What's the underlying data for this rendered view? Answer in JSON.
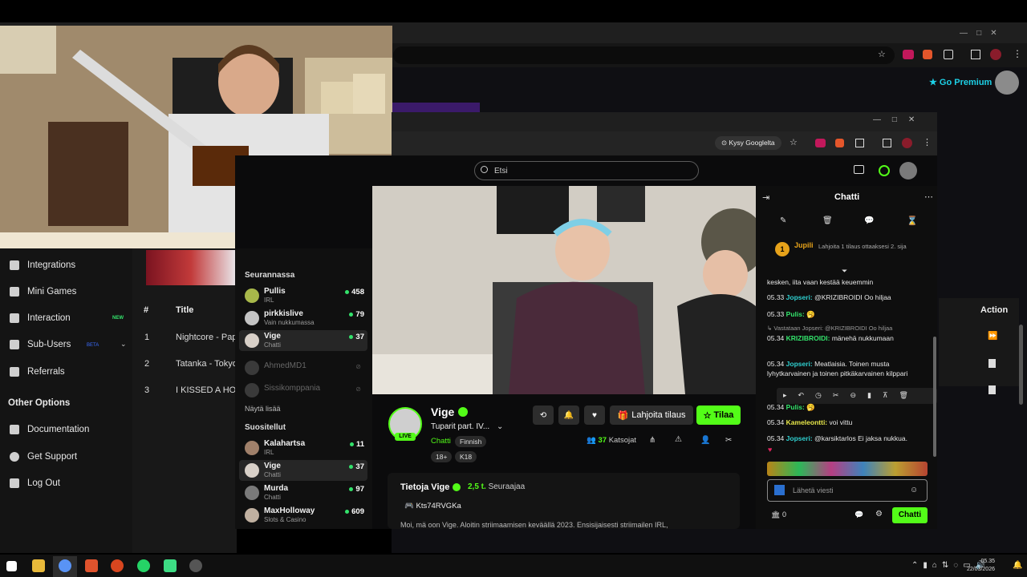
{
  "outer": {
    "go_premium": "Go Premium"
  },
  "sidebar": {
    "items": [
      {
        "label": "Integrations"
      },
      {
        "label": "Mini Games"
      },
      {
        "label": "Interaction",
        "badge": "NEW"
      },
      {
        "label": "Sub-Users",
        "badge": "BETA"
      },
      {
        "label": "Referrals"
      }
    ],
    "other_options": "Other Options",
    "other_items": [
      {
        "label": "Documentation"
      },
      {
        "label": "Get Support"
      },
      {
        "label": "Log Out"
      }
    ]
  },
  "song_table": {
    "headers": {
      "num": "#",
      "title": "Title",
      "action": "Action"
    },
    "rows": [
      {
        "num": "1",
        "title": "Nightcore - Pap"
      },
      {
        "num": "2",
        "title": "Tatanka - Tokyo"
      },
      {
        "num": "3",
        "title": "I KISSED A HOR"
      }
    ]
  },
  "inner_browser": {
    "ask_google": "Kysy Googlelta",
    "search_placeholder": "Etsi"
  },
  "follows": {
    "following_title": "Seurannassa",
    "following": [
      {
        "name": "Pullis",
        "sub": "IRL",
        "count": "458"
      },
      {
        "name": "pirkkislive",
        "sub": "Vain nukkumassa",
        "count": "79"
      },
      {
        "name": "Vige",
        "sub": "Chatti",
        "count": "37"
      },
      {
        "name": "AhmedMD1",
        "sub": "",
        "count": ""
      },
      {
        "name": "Sissikomppania",
        "sub": "",
        "count": ""
      }
    ],
    "show_more": "Näytä lisää",
    "recommended_title": "Suositellut",
    "recommended": [
      {
        "name": "Kalahartsa",
        "sub": "IRL",
        "count": "11"
      },
      {
        "name": "Vige",
        "sub": "Chatti",
        "count": "37"
      },
      {
        "name": "Murda",
        "sub": "Chatti",
        "count": "97"
      },
      {
        "name": "MaxHolloway",
        "sub": "Slots & Casino",
        "count": "609"
      }
    ]
  },
  "stream": {
    "streamer": "Vige",
    "title": "Tuparit part. IV...",
    "category": "Chatti",
    "tags": [
      "Finnish",
      "18+",
      "K18"
    ],
    "live": "LIVE",
    "gift_button": "Lahjoita tilaus",
    "subscribe_button": "Tilaa",
    "viewers": "37",
    "viewers_label": "Katsojat",
    "about_title": "Tietoja Vige",
    "followers": "2,5 t.",
    "followers_label": "Seuraajaa",
    "discord": "Kts74RVGKa",
    "bio": "Moi, mä oon Vige. Aloitin striimaamisen keväällä 2023. Ensisijaisesti striimailen IRL,"
  },
  "chat": {
    "title": "Chatti",
    "pinned_user": "Jupili",
    "pinned_rank": "1",
    "pinned_text": "Lahjoita 1 tilaus ottaaksesi 2. sija",
    "messages": [
      {
        "time": "",
        "user": "",
        "text": "kesken, iita vaan kestää keuemmin"
      },
      {
        "time": "05.33",
        "user": "Jopseri:",
        "text": "@KRIZIBROIDI Oo hiljaa"
      },
      {
        "time": "05.33",
        "user": "Pulis:",
        "text": "🥱"
      },
      {
        "time": "",
        "user": "",
        "text": "Vastataan Jopseri: @KRIZIBROIDI Oo hiljaa"
      },
      {
        "time": "05.34",
        "user": "KRIZIBROIDI:",
        "text": "mänehä nukkumaan"
      },
      {
        "time": "05.34",
        "user": "Jopseri:",
        "text": "Meatlaisia. Toinen musta lyhytkarvainen ja toinen pitkäkarvainen kilppari"
      },
      {
        "time": "05.34",
        "user": "Pulis:",
        "text": "🥱"
      },
      {
        "time": "05.34",
        "user": "Kameleontti:",
        "text": "voi vittu"
      },
      {
        "time": "05.34",
        "user": "Jopseri:",
        "text": "@karsiktarlos Ei jaksa nukkua."
      }
    ],
    "input_placeholder": "Lähetä viesti",
    "points": "0",
    "send_button": "Chatti"
  },
  "taskbar": {
    "time": "05.35",
    "date": "22/03/2026"
  },
  "colors": {
    "kick_green": "#53fc18",
    "premium_cyan": "#1dd0e6",
    "username_green": "#33e36b",
    "username_cyan": "#2fd0d0"
  }
}
